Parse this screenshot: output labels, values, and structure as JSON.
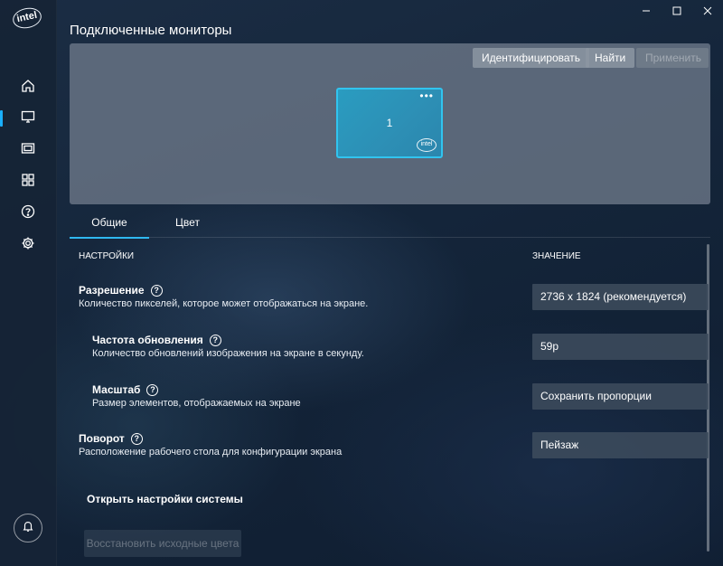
{
  "app": {
    "logo_text": "intel"
  },
  "sidebar": {
    "items": [
      {
        "name": "home-icon",
        "active": false
      },
      {
        "name": "display-icon",
        "active": true
      },
      {
        "name": "video-icon",
        "active": false
      },
      {
        "name": "apps-grid-icon",
        "active": false
      },
      {
        "name": "help-icon",
        "active": false
      },
      {
        "name": "gear-icon",
        "active": false
      }
    ],
    "bottom_icon": "bell-icon"
  },
  "window": {
    "controls": [
      "minimize-icon",
      "maximize-icon",
      "close-icon"
    ]
  },
  "header": {
    "title": "Подключенные мониторы"
  },
  "monitors": {
    "identify_label": "Идентифицировать",
    "find_label": "Найти",
    "apply_label": "Применить",
    "tile": {
      "number": "1",
      "menu": "•••",
      "logo": "intel"
    }
  },
  "tabs": [
    {
      "label": "Общие",
      "active": true
    },
    {
      "label": "Цвет",
      "active": false
    }
  ],
  "table": {
    "settings_header": "НАСТРОЙКИ",
    "value_header": "ЗНАЧЕНИЕ"
  },
  "settings": [
    {
      "title": "Разрешение",
      "description": "Количество пикселей, которое может отображаться на экране.",
      "value": "2736 x 1824 (рекомендуется)"
    },
    {
      "title": "Частота обновления",
      "description": "Количество обновлений изображения на экране в секунду.",
      "value": "59p"
    },
    {
      "title": "Масштаб",
      "description": "Размер элементов, отображаемых на экране",
      "value": "Сохранить пропорции"
    },
    {
      "title": "Поворот",
      "description": "Расположение рабочего стола для конфигурации экрана",
      "value": "Пейзаж"
    }
  ],
  "footer": {
    "open_system_settings": "Открыть настройки системы",
    "restore_colors": "Восстановить исходные цвета"
  },
  "colors": {
    "accent": "#1ab0ff",
    "tile_border": "#31c4ef"
  }
}
